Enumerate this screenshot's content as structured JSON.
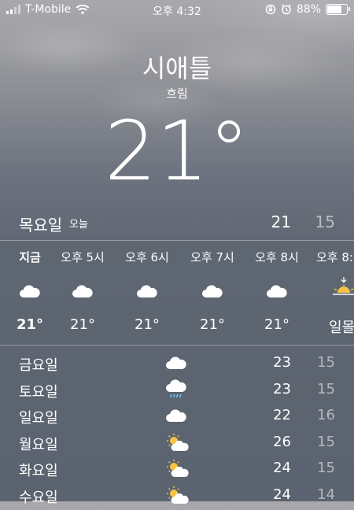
{
  "status_bar": {
    "carrier": "T-Mobile",
    "time": "오후 4:32",
    "battery": "88%",
    "battery_level": 0.88
  },
  "header": {
    "city": "시애틀",
    "condition": "흐림",
    "temperature": "21°"
  },
  "today": {
    "day": "목요일",
    "tag": "오늘",
    "high": "21",
    "low": "15"
  },
  "hourly": [
    {
      "label": "지금",
      "icon": "cloud-icon",
      "temp": "21°",
      "bold": true
    },
    {
      "label": "오후 5시",
      "icon": "cloud-icon",
      "temp": "21°",
      "bold": false
    },
    {
      "label": "오후 6시",
      "icon": "cloud-icon",
      "temp": "21°",
      "bold": false
    },
    {
      "label": "오후 7시",
      "icon": "cloud-icon",
      "temp": "21°",
      "bold": false
    },
    {
      "label": "오후 8시",
      "icon": "cloud-icon",
      "temp": "21°",
      "bold": false
    },
    {
      "label": "오후 8:",
      "icon": "sunset-icon",
      "temp": "일몰",
      "bold": false
    }
  ],
  "daily": [
    {
      "day": "금요일",
      "icon": "cloud-icon",
      "high": "23",
      "low": "15"
    },
    {
      "day": "토요일",
      "icon": "rain-cloud-icon",
      "high": "23",
      "low": "15"
    },
    {
      "day": "일요일",
      "icon": "cloud-icon",
      "high": "22",
      "low": "16"
    },
    {
      "day": "월요일",
      "icon": "partly-sunny-icon",
      "high": "26",
      "low": "15"
    },
    {
      "day": "화요일",
      "icon": "partly-sunny-icon",
      "high": "24",
      "low": "15"
    },
    {
      "day": "수요일",
      "icon": "partly-sunny-icon",
      "high": "24",
      "low": "14"
    }
  ]
}
